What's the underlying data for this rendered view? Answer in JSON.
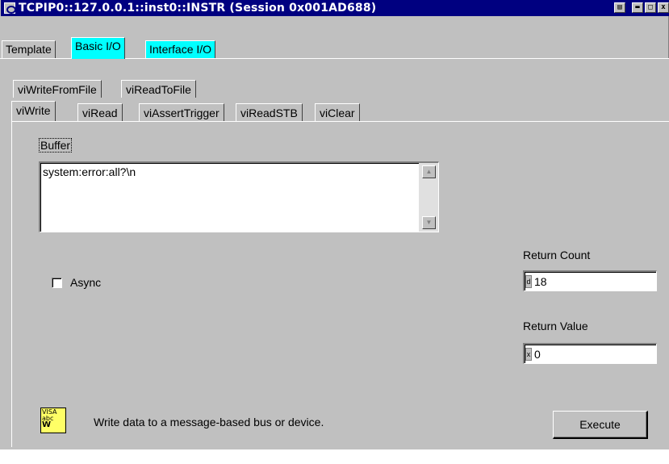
{
  "window": {
    "title": "TCPIP0::127.0.0.1::inst0::INSTR (Session 0x001AD688)",
    "controls": [
      "▤",
      "▬",
      "□",
      "x"
    ]
  },
  "top_tabs": [
    {
      "label": "Template",
      "active": false
    },
    {
      "label": "Basic I/O",
      "active": true
    },
    {
      "label": "Interface I/O",
      "active": false
    }
  ],
  "inner_tabs_row1": [
    {
      "label": "viWriteFromFile"
    },
    {
      "label": "viReadToFile"
    }
  ],
  "inner_tabs_row2": [
    {
      "label": "viWrite",
      "active": true
    },
    {
      "label": "viRead"
    },
    {
      "label": "viAssertTrigger"
    },
    {
      "label": "viReadSTB"
    },
    {
      "label": "viClear"
    }
  ],
  "buffer": {
    "label": "Buffer",
    "value": "system:error:all?\\n"
  },
  "async": {
    "label": "Async",
    "checked": false
  },
  "return_count": {
    "label": "Return Count",
    "radix": "d",
    "value": "18"
  },
  "return_value": {
    "label": "Return Value",
    "radix": "x",
    "value": "0"
  },
  "footer": {
    "icon_lines": [
      "VISA",
      "abc",
      "W"
    ],
    "description": "Write data to a message-based bus or device.",
    "execute_label": "Execute"
  }
}
